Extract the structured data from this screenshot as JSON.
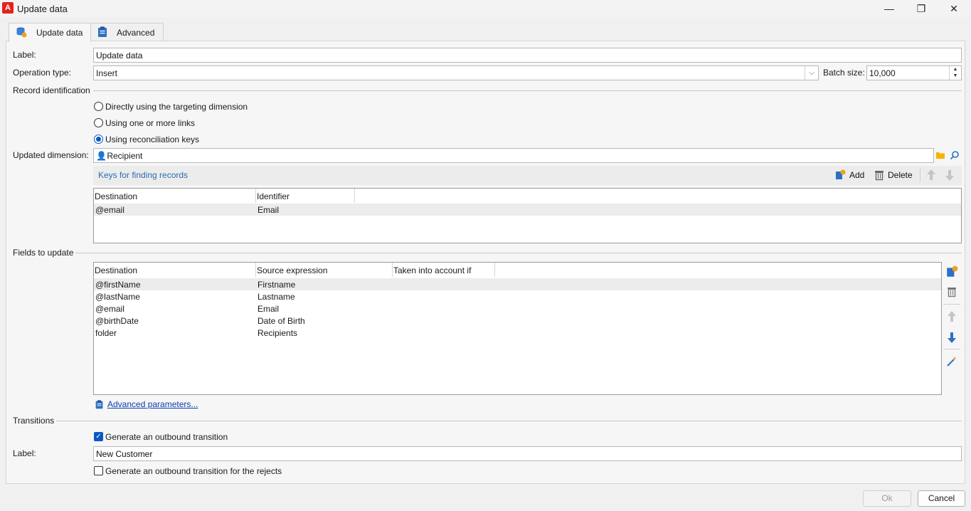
{
  "window": {
    "title": "Update data",
    "app_icon_letter": "A",
    "minimize": "—",
    "maximize": "❐",
    "close": "✕"
  },
  "tabs": [
    {
      "label": "Update data",
      "icon": "database-refresh-icon"
    },
    {
      "label": "Advanced",
      "icon": "clipboard-icon"
    }
  ],
  "form": {
    "label_caption": "Label:",
    "label_value": "Update data",
    "operation_caption": "Operation type:",
    "operation_value": "Insert",
    "batch_caption": "Batch size:",
    "batch_value": "10,000"
  },
  "record_identification": {
    "title": "Record identification",
    "options": [
      {
        "label": "Directly using the targeting dimension",
        "selected": false
      },
      {
        "label": "Using one or more links",
        "selected": false
      },
      {
        "label": "Using reconciliation keys",
        "selected": true
      }
    ],
    "dimension_caption": "Updated dimension:",
    "dimension_value": "Recipient"
  },
  "keys": {
    "title": "Keys for finding records",
    "add_label": "Add",
    "delete_label": "Delete",
    "columns": [
      "Destination",
      "Identifier"
    ],
    "rows": [
      {
        "destination": "@email",
        "identifier": "Email"
      }
    ]
  },
  "fields": {
    "title": "Fields to update",
    "columns": [
      "Destination",
      "Source expression",
      "Taken into account if"
    ],
    "rows": [
      {
        "destination": "@firstName",
        "source": "Firstname"
      },
      {
        "destination": "@lastName",
        "source": "Lastname"
      },
      {
        "destination": "@email",
        "source": "Email"
      },
      {
        "destination": "@birthDate",
        "source": "Date of Birth"
      },
      {
        "destination": "folder",
        "source": "Recipients"
      }
    ],
    "advanced_link": "Advanced parameters..."
  },
  "transitions": {
    "title": "Transitions",
    "generate_label": "Generate an outbound transition",
    "generate_checked": true,
    "label_caption": "Label:",
    "label_value": "New Customer",
    "rejects_label": "Generate an outbound transition for the rejects",
    "rejects_checked": false
  },
  "footer": {
    "ok_label": "Ok",
    "cancel_label": "Cancel"
  },
  "colors": {
    "accent": "#0a58c4",
    "app_brand": "#e2231a",
    "link": "#2b6cb0"
  }
}
